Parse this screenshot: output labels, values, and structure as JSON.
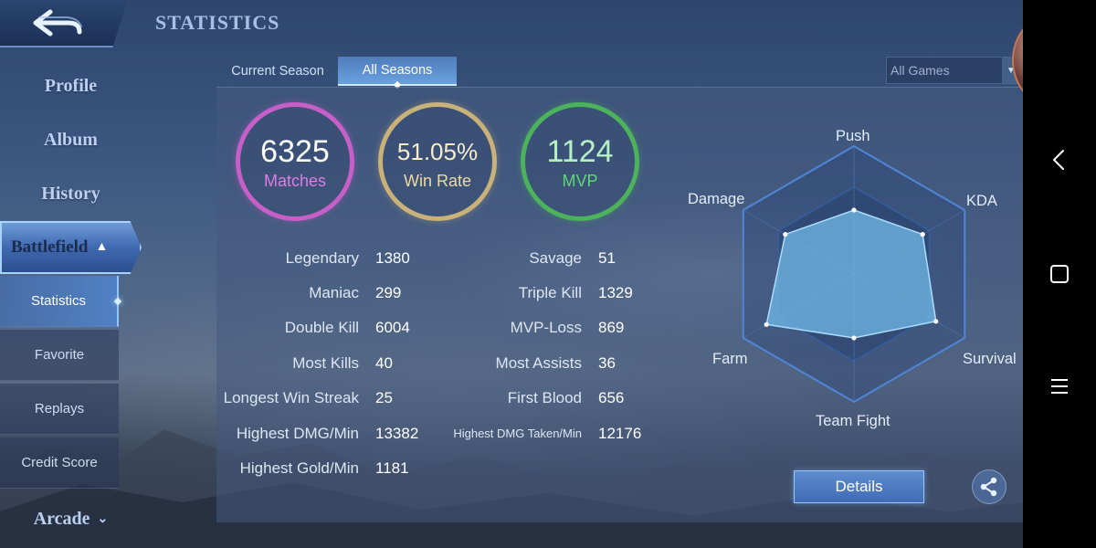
{
  "header": {
    "title": "STATISTICS"
  },
  "sidebar": {
    "items": [
      {
        "label": "Profile"
      },
      {
        "label": "Album"
      },
      {
        "label": "History"
      },
      {
        "label": "Battlefield"
      }
    ],
    "battlefield_sub": [
      {
        "label": "Statistics",
        "active": true
      },
      {
        "label": "Favorite"
      },
      {
        "label": "Replays"
      },
      {
        "label": "Credit Score"
      }
    ],
    "arcade_label": "Arcade"
  },
  "tabs": [
    {
      "label": "Current Season",
      "active": false
    },
    {
      "label": "All Seasons",
      "active": true
    }
  ],
  "filter": {
    "selected": "All Games"
  },
  "summary": {
    "matches": {
      "value": "6325",
      "label": "Matches",
      "color": "#c75fc8"
    },
    "win_rate": {
      "value": "51.05%",
      "label": "Win Rate",
      "color": "#c9b27a"
    },
    "mvp": {
      "value": "1124",
      "label": "MVP",
      "color": "#4cb25b"
    }
  },
  "stats_left": [
    {
      "label": "Legendary",
      "value": "1380"
    },
    {
      "label": "Maniac",
      "value": "299"
    },
    {
      "label": "Double Kill",
      "value": "6004"
    },
    {
      "label": "Most Kills",
      "value": "40"
    },
    {
      "label": "Longest Win Streak",
      "value": "25"
    },
    {
      "label": "Highest DMG/Min",
      "value": "13382"
    },
    {
      "label": "Highest Gold/Min",
      "value": "1181"
    }
  ],
  "stats_right": [
    {
      "label": "Savage",
      "value": "51"
    },
    {
      "label": "Triple Kill",
      "value": "1329"
    },
    {
      "label": "MVP-Loss",
      "value": "869"
    },
    {
      "label": "Most Assists",
      "value": "36"
    },
    {
      "label": "First Blood",
      "value": "656"
    },
    {
      "label": "Highest DMG Taken/Min",
      "value": "12176"
    }
  ],
  "radar": {
    "axes": [
      "Push",
      "KDA",
      "Survival",
      "Team Fight",
      "Farm",
      "Damage"
    ],
    "values": [
      0.5,
      0.62,
      0.74,
      0.5,
      0.79,
      0.62
    ],
    "fill_color": "#6fb6e4"
  },
  "actions": {
    "details_label": "Details",
    "share_icon": "share-icon"
  },
  "system_nav": {
    "back_icon": "chevron-left-icon",
    "home_icon": "square-icon",
    "menu_icon": "menu-icon"
  }
}
